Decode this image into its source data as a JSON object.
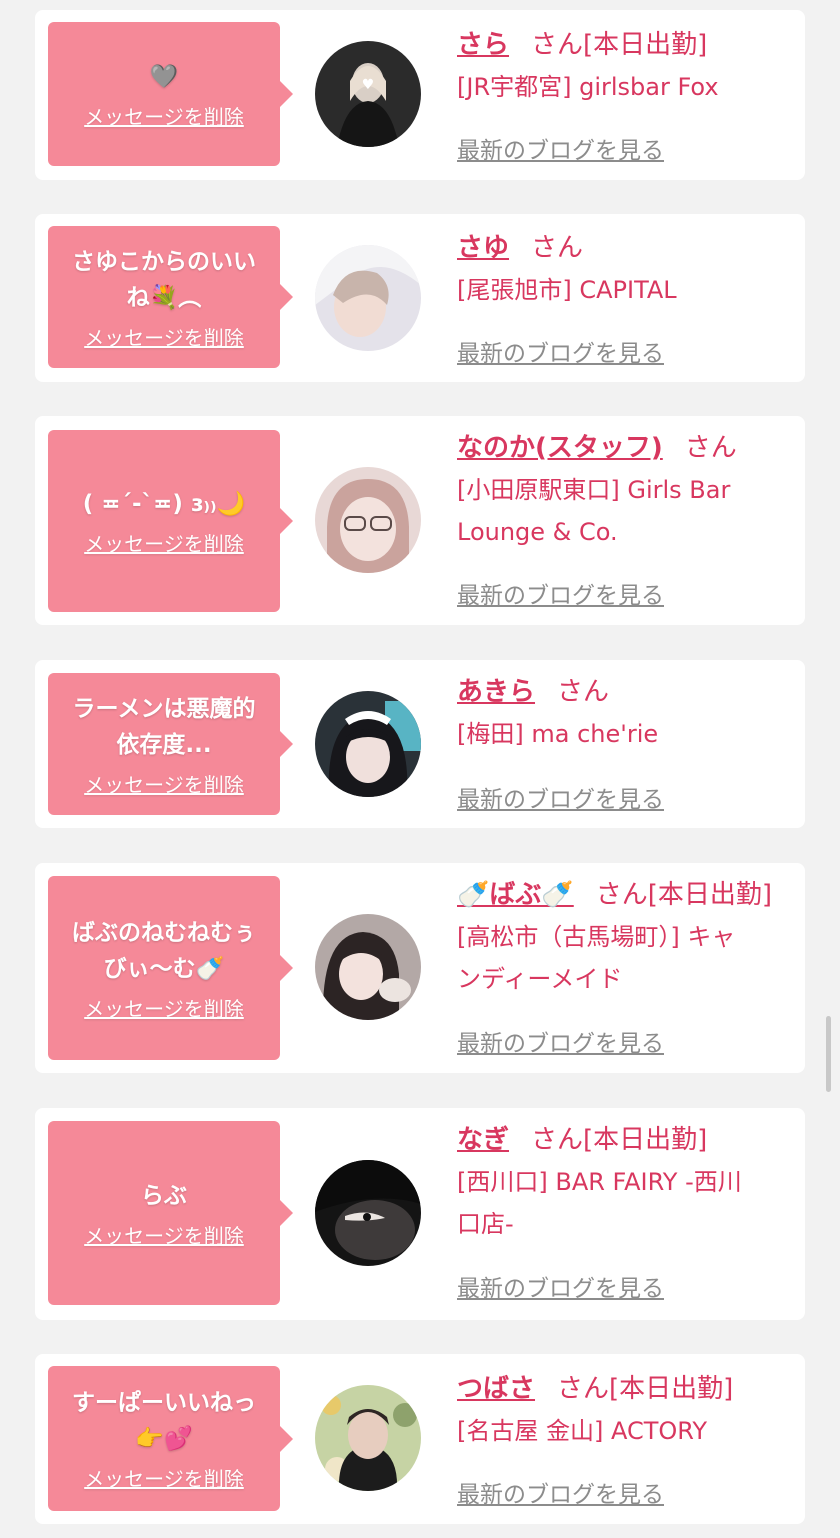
{
  "common": {
    "delete_label": "メッセージを削除",
    "san_label": "さん",
    "blog_label": "最新のブログを見る"
  },
  "colors": {
    "page_background": "#f2f2f2",
    "card_background": "#ffffff",
    "bubble_pink": "#f58998",
    "accent_name": "#d8375f",
    "link_gray": "#8c8c8c"
  },
  "cards": [
    {
      "message_lines": [
        "🩶"
      ],
      "name": "さら",
      "status": "[本日出勤]",
      "shop_lines": [
        "[JR宇都宮] girlsbar Fox"
      ],
      "avatar_icon": "profile-photo"
    },
    {
      "message_lines": [
        "さゆこからのいい",
        "ね💐︵"
      ],
      "name": "さゆ",
      "status": "",
      "shop_lines": [
        "[尾張旭市] CAPITAL"
      ],
      "avatar_icon": "profile-photo"
    },
    {
      "message_lines": [
        "( ≖ˊ-ˋ≖) ɜ₎₎🌙"
      ],
      "name": "なのか(スタッフ)",
      "status": "",
      "shop_lines": [
        "[小田原駅東口] Girls Bar",
        "Lounge & Co."
      ],
      "avatar_icon": "profile-photo"
    },
    {
      "message_lines": [
        "ラーメンは悪魔的",
        "依存度..."
      ],
      "name": "あきら",
      "status": "",
      "shop_lines": [
        "[梅田] ma che'rie"
      ],
      "avatar_icon": "profile-photo"
    },
    {
      "message_lines": [
        "ばぶのねむねむぅ",
        "びぃ〜む🍼"
      ],
      "name": "🍼ばぶ🍼",
      "status": "[本日出勤]",
      "shop_lines": [
        "[高松市（古馬場町）] キャ",
        "ンディーメイド"
      ],
      "avatar_icon": "profile-photo"
    },
    {
      "message_lines": [
        "らぶ"
      ],
      "name": "なぎ",
      "status": "[本日出勤]",
      "shop_lines": [
        "[西川口] BAR FAIRY -西川",
        "口店-"
      ],
      "avatar_icon": "profile-photo"
    },
    {
      "message_lines": [
        "すーぱーいいねっ",
        "👉💕"
      ],
      "name": "つばさ",
      "status": "[本日出勤]",
      "shop_lines": [
        "[名古屋 金山] ACTORY"
      ],
      "avatar_icon": "profile-photo"
    }
  ]
}
